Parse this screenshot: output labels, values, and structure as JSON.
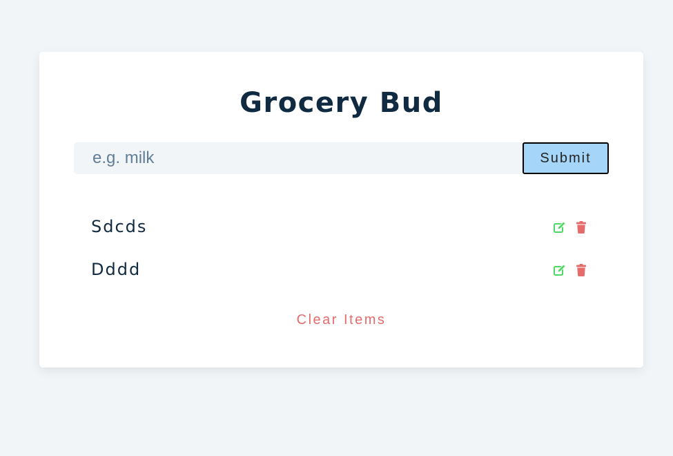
{
  "app": {
    "title": "Grocery Bud"
  },
  "form": {
    "input_value": "",
    "placeholder": "e.g. milk",
    "submit_label": "Submit"
  },
  "items": [
    {
      "title": "Sdcds",
      "edit_icon": "edit-icon",
      "delete_icon": "trash-icon"
    },
    {
      "title": "Dddd",
      "edit_icon": "edit-icon",
      "delete_icon": "trash-icon"
    }
  ],
  "clear_label": "Clear Items",
  "colors": {
    "background": "#f1f5f8",
    "card": "#ffffff",
    "title": "#102a42",
    "submit_bg": "#a5d5f8",
    "edit": "#4cd964",
    "delete": "#e66b6b",
    "clear": "#e66b6b"
  }
}
